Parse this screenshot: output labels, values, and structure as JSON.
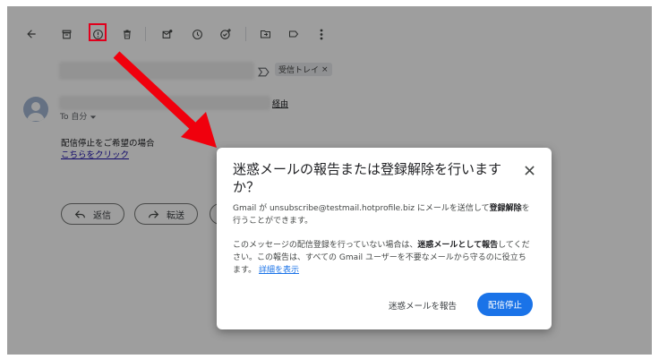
{
  "message": {
    "label_chip": "受信トレイ",
    "label_chip_close": "×",
    "via_text": "経由",
    "to_me": "To 自分",
    "body_line1": "配信停止をご希望の場合",
    "body_link": "こちらをクリック"
  },
  "actions": {
    "reply": "返信",
    "forward": "転送"
  },
  "dialog": {
    "title": "迷惑メールの報告または登録解除を行いますか？",
    "close": "×",
    "p1_a": "Gmail が unsubscribe@testmail.hotprofile.biz にメールを送信して",
    "p1_b": "登録解除",
    "p1_c": "を行うことができます。",
    "p2_a": "このメッセージの配信登録を行っていない場合は、",
    "p2_b": "迷惑メールとして報告",
    "p2_c": "してください。この報告は、すべての Gmail ユーザーを不要なメールから守るのに役立ちます。",
    "learn_more": "詳細を表示",
    "report_button": "迷惑メールを報告",
    "unsubscribe_button": "配信停止"
  },
  "colors": {
    "annotation_red": "#e1001c",
    "primary_blue": "#1a73e8"
  }
}
